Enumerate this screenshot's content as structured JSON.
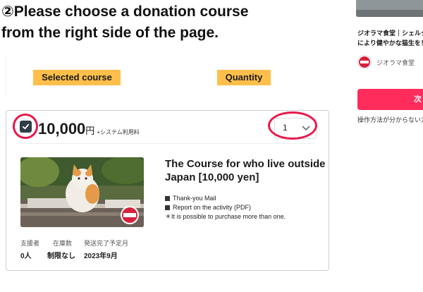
{
  "heading": {
    "line1": "②Please choose a donation course",
    "line2": "from the right side of the page."
  },
  "tags": {
    "selected_course": "Selected course",
    "quantity": "Quantity"
  },
  "course": {
    "checked": true,
    "price": "10,000",
    "currency": "円",
    "fee_note": "+システム利用料",
    "quantity": "1",
    "title": "The Course for who live outside Japan [10,000 yen]",
    "benefits": [
      "Thank-you Mail",
      "Report on the activity (PDF)"
    ],
    "note": "＊It is possible to purchase more than one.",
    "stats": {
      "supporters_label": "支援者",
      "supporters_value": "0人",
      "stock_label": "在庫数",
      "stock_value": "制限なし",
      "ship_label": "発送完了予定月",
      "ship_value": "2023年9月"
    }
  },
  "sidebar": {
    "project_title_line1": "ジオラマ食堂｜シェルタ",
    "project_title_line2": "により健やかな猫生を！",
    "owner": "ジオラマ食堂",
    "next_button": "次",
    "help_text": "操作方法が分からない方"
  },
  "colors": {
    "accent_red": "#e8194b",
    "tag_orange": "#ffbf4a",
    "button_pink": "#ff2c5c"
  },
  "icons": {
    "checkbox": "check-icon",
    "dropdown": "chevron-down-icon"
  }
}
